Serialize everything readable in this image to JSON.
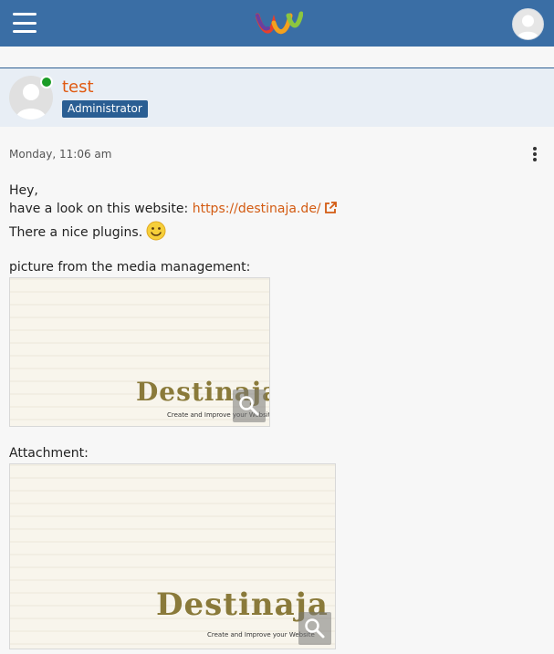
{
  "header": {
    "menu_icon": "hamburger-menu-icon",
    "logo_icon": "brand-logo-icon",
    "user_icon": "user-avatar-icon"
  },
  "post": {
    "author_name": "test",
    "author_role": "Administrator",
    "online": true,
    "timestamp": "Monday, 11:06 am",
    "lines": {
      "greeting": "Hey,",
      "look_prefix": "have a look on this website: ",
      "link_text": "https://destinaja.de/",
      "plugins": "There a nice plugins.",
      "media_label": "picture from the media management:",
      "attachment_label": "Attachment:"
    },
    "images": {
      "media": {
        "logo_text": "Destinaja",
        "tagline": "Create and Improve your Website"
      },
      "attachment": {
        "logo_text": "Destinaja",
        "tagline": "Create and Improve your Website"
      }
    }
  },
  "colors": {
    "header_bg": "#3a6ea5",
    "accent_orange": "#e05a12",
    "badge_bg": "#2a5e93",
    "online_green": "#1a9c26"
  }
}
